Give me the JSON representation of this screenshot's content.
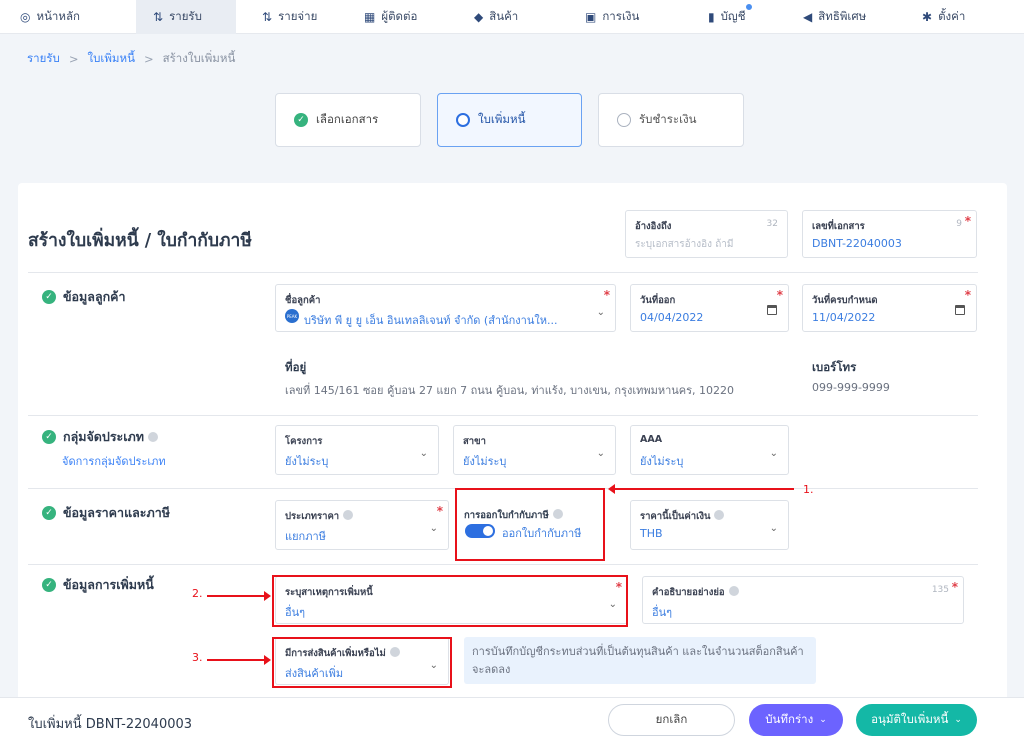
{
  "nav": [
    {
      "icon": "◎",
      "label": "หน้าหลัก"
    },
    {
      "icon": "⇅",
      "label": "รายรับ"
    },
    {
      "icon": "⇅",
      "label": "รายจ่าย"
    },
    {
      "icon": "▦",
      "label": "ผู้ติดต่อ"
    },
    {
      "icon": "◆",
      "label": "สินค้า"
    },
    {
      "icon": "▣",
      "label": "การเงิน"
    },
    {
      "icon": "▮",
      "label": "บัญชี"
    },
    {
      "icon": "◀",
      "label": "สิทธิพิเศษ"
    },
    {
      "icon": "✱",
      "label": "ตั้งค่า"
    }
  ],
  "breadcrumb": {
    "root": "รายรับ",
    "sep1": ">",
    "parent": "ใบเพิ่มหนี้",
    "sep2": ">",
    "current": "สร้างใบเพิ่มหนี้"
  },
  "steps": [
    {
      "label": "เลือกเอกสาร"
    },
    {
      "label": "ใบเพิ่มหนี้"
    },
    {
      "label": "รับชำระเงิน"
    }
  ],
  "page_title": "สร้างใบเพิ่มหนี้ / ใบกำกับภาษี",
  "reference": {
    "label": "อ้างอิงถึง",
    "count": "32",
    "placeholder": "ระบุเอกสารอ้างอิง ถ้ามี"
  },
  "doc_number": {
    "label": "เลขที่เอกสาร",
    "count": "9",
    "required": "*",
    "value": "DBNT-22040003"
  },
  "customer_section": {
    "title": "ข้อมูลลูกค้า",
    "customer_label": "ชื่อลูกค้า",
    "customer_value": "บริษัท พี ยู ยู เอ็น อินเทลลิเจนท์ จำกัด (สำนักงานให...",
    "customer_avatar": "PEAK",
    "issue_date_label": "วันที่ออก",
    "issue_date": "04/04/2022",
    "due_date_label": "วันที่ครบกำหนด",
    "due_date": "11/04/2022",
    "address_label": "ที่อยู่",
    "address": "เลขที่ 145/161 ซอย คู้บอน 27 แยก 7 ถนน คู้บอน, ท่าแร้ง, บางเขน, กรุงเทพมหานคร, 10220",
    "phone_label": "เบอร์โทร",
    "phone": "099-999-9999"
  },
  "group_section": {
    "title": "กลุ่มจัดประเภท",
    "manage_link": "จัดการกลุ่มจัดประเภท",
    "project_label": "โครงการ",
    "project_value": "ยังไม่ระบุ",
    "branch_label": "สาขา",
    "branch_value": "ยังไม่ระบุ",
    "aaa_label": "AAA",
    "aaa_value": "ยังไม่ระบุ"
  },
  "price_section": {
    "title": "ข้อมูลราคาและภาษี",
    "price_type_label": "ประเภทราคา",
    "price_type_value": "แยกภาษี",
    "tax_invoice_label": "การออกใบกำกับภาษี",
    "tax_invoice_value": "ออกใบกำกับภาษี",
    "currency_label": "ราคานี้เป็นค่าเงิน",
    "currency_value": "THB"
  },
  "debit_section": {
    "title": "ข้อมูลการเพิ่มหนี้",
    "reason_label": "ระบุสาเหตุการเพิ่มหนี้",
    "reason_value": "อื่นๆ",
    "desc_label": "คำอธิบายอย่างย่อ",
    "desc_count": "135",
    "desc_value": "อื่นๆ",
    "extra_label": "มีการส่งสินค้าเพิ่มหรือไม่",
    "extra_value": "ส่งสินค้าเพิ่ม",
    "note": "การบันทึกบัญชีกระทบส่วนที่เป็นต้นทุนสินค้า และในจำนวนสต็อกสินค้าจะลดลง"
  },
  "annotations": {
    "a1": "1.",
    "a2": "2.",
    "a3": "3."
  },
  "footer": {
    "doc_title": "ใบเพิ่มหนี้ DBNT-22040003",
    "cancel": "ยกเลิก",
    "draft": "บันทึกร่าง",
    "approve": "อนุมัติใบเพิ่มหนี้"
  },
  "colors": {
    "accent": "#3b82f6",
    "success": "#36b37e",
    "draft": "#6c63ff",
    "approve": "#14b8a6",
    "annotation": "#e8111a"
  }
}
